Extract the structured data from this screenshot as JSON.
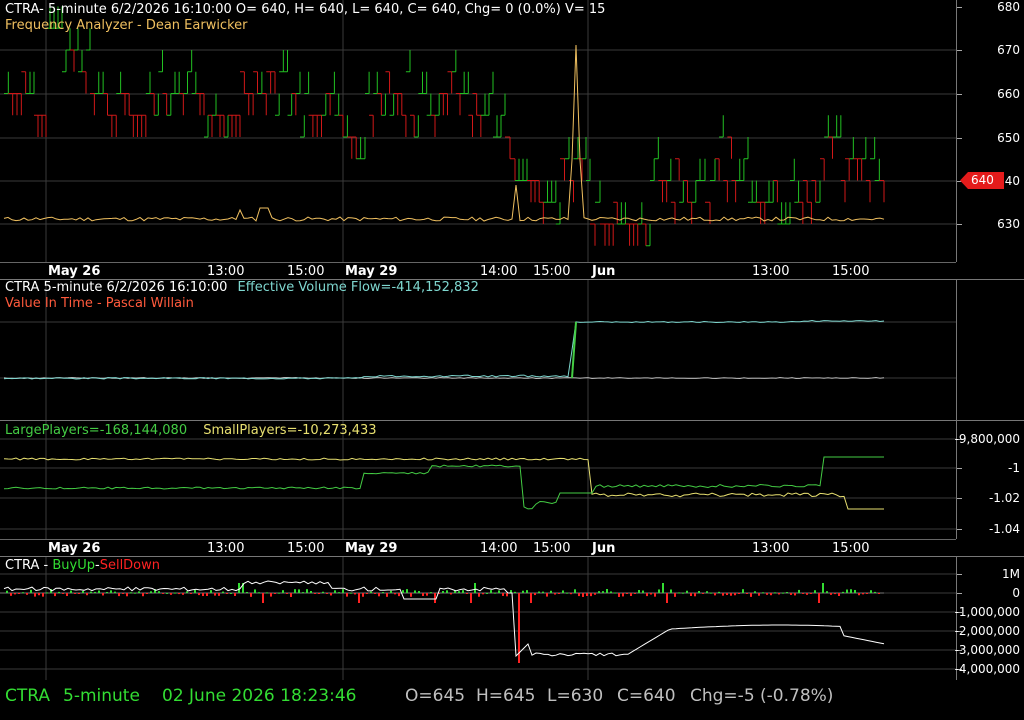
{
  "colors": {
    "background": "#000000",
    "grid": "#3a3a3a",
    "price_up": "#22c022",
    "price_down": "#d01818",
    "frequency_line": "#f0c060",
    "evf_line": "#7fd8d0",
    "value_in_time": "#ff5a3c",
    "large_players": "#44cc44",
    "small_players": "#e8e070",
    "buyup": "#33dd33",
    "selldown": "#ff2222",
    "status_green": "#33dd33",
    "status_gray": "#bfbfbf"
  },
  "panel1": {
    "header_line1": "CTRA- 5-minute 6/2/2026 16:10:00 O= 640, H= 640, L= 640, C= 640, Chg= 0 (0.0%) V= 15",
    "header_line2": "Frequency Analyzer - Dean Earwicker",
    "y_ticks": [
      "680",
      "670",
      "660",
      "650",
      "640",
      "630"
    ],
    "last_price_tag": "640"
  },
  "time_axis": {
    "labels": [
      {
        "text": "May 26",
        "day": true
      },
      {
        "text": "13:00",
        "day": false
      },
      {
        "text": "15:00",
        "day": false
      },
      {
        "text": "May 29",
        "day": true
      },
      {
        "text": "14:00",
        "day": false
      },
      {
        "text": "15:00",
        "day": false
      },
      {
        "text": "Jun",
        "day": true
      },
      {
        "text": "13:00",
        "day": false
      },
      {
        "text": "15:00",
        "day": false
      }
    ]
  },
  "panel2": {
    "header_prefix": "CTRA 5-minute  6/2/2026 16:10:00",
    "header_indicator": "Effective Volume Flow=-414,152,832",
    "header_line2": "Value In Time - Pascal Willain"
  },
  "panel3": {
    "large_players": "LargePlayers=-168,144,080",
    "small_players": "SmallPlayers=-10,273,433",
    "y_ticks": [
      "-9,800,000",
      "-1",
      "-1.02",
      "-1.04"
    ]
  },
  "panel4": {
    "prefix": "CTRA - ",
    "buyup": "BuyUp",
    "dash": "-",
    "selldown": "SellDown",
    "y_ticks": [
      "1M",
      "0",
      "-1,000,000",
      "-2,000,000",
      "-3,000,000",
      "-4,000,000"
    ]
  },
  "status_bar": {
    "symbol": "CTRA",
    "interval": "5-minute",
    "datetime": "02 June 2026 18:23:46",
    "open": "O=645",
    "high": "H=645",
    "low": "L=630",
    "close": "C=640",
    "change": "Chg=-5 (-0.78%)"
  }
}
